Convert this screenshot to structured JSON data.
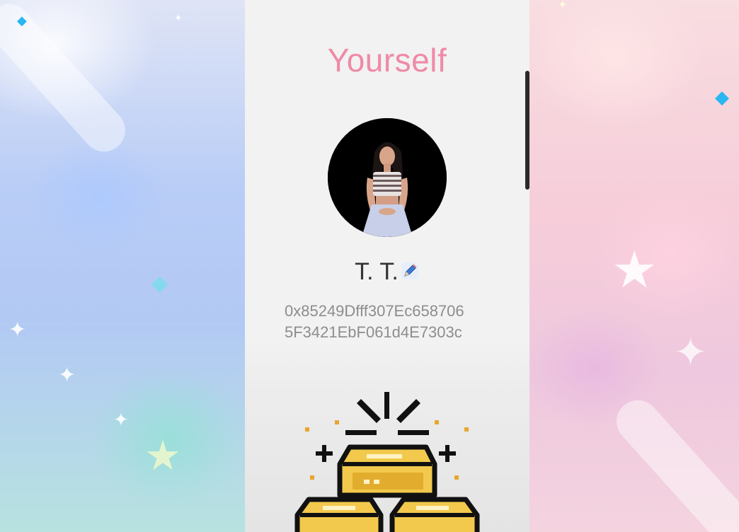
{
  "profile": {
    "title": "Yourself",
    "name": "T. T.",
    "wallet_line_1": "0x85249Dfff307Ec658706",
    "wallet_line_2": "5F3421EbF061d4E7303c"
  },
  "icons": {
    "edit": "pencil-icon",
    "reward": "gold-bars-icon"
  },
  "colors": {
    "title": "#ef8aa6",
    "panel": "#f2f2f2",
    "gold": "#f2c94c",
    "accent_blue": "#29b7f2"
  }
}
